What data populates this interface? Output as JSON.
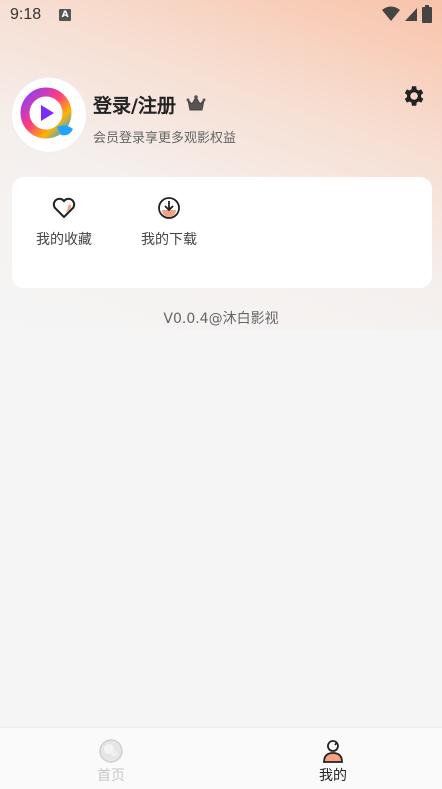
{
  "status_bar": {
    "time": "9:18",
    "notification_letter": "A"
  },
  "profile": {
    "name": "登录/注册",
    "subtitle": "会员登录享更多观影权益"
  },
  "shortcuts": [
    {
      "label": "我的收藏",
      "icon": "heart-icon"
    },
    {
      "label": "我的下载",
      "icon": "download-icon"
    }
  ],
  "version": "V0.0.4@沐白影视",
  "tabs": [
    {
      "label": "首页",
      "icon": "home-icon",
      "active": false
    },
    {
      "label": "我的",
      "icon": "profile-icon",
      "active": true
    }
  ],
  "colors": {
    "accent": "#f08a5d",
    "gradient_top": "#f8c3a9",
    "background": "#f5f5f5"
  }
}
